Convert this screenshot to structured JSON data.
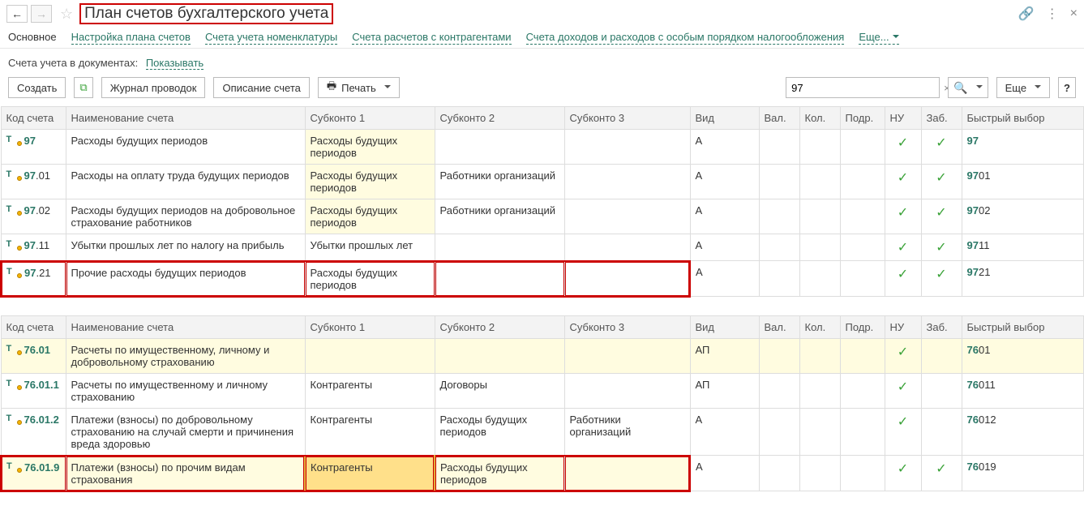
{
  "header": {
    "title": "План счетов бухгалтерского учета"
  },
  "tabs": {
    "main": "Основное",
    "setup": "Настройка плана счетов",
    "nomen": "Счета учета номенклатуры",
    "counter": "Счета расчетов с контрагентами",
    "tax": "Счета доходов и расходов с особым порядком налогообложения",
    "more": "Еще..."
  },
  "sub": {
    "label": "Счета учета в документах:",
    "value": "Показывать"
  },
  "toolbar": {
    "create": "Создать",
    "journal": "Журнал проводок",
    "describe": "Описание счета",
    "print": "Печать",
    "more": "Еще",
    "help": "?"
  },
  "search": {
    "value": "97"
  },
  "columns": {
    "code": "Код счета",
    "name": "Наименование счета",
    "sub1": "Субконто 1",
    "sub2": "Субконто 2",
    "sub3": "Субконто 3",
    "vid": "Вид",
    "val": "Вал.",
    "kol": "Кол.",
    "pod": "Подр.",
    "nu": "НУ",
    "zab": "Заб.",
    "fast": "Быстрый выбор"
  },
  "rows1": [
    {
      "icon": "plan",
      "code": "97",
      "codeSuf": "",
      "name": "Расходы будущих периодов",
      "sub1": "Расходы будущих периодов",
      "sub2": "",
      "sub3": "",
      "vid": "А",
      "nu": true,
      "zab": true,
      "fast": "97",
      "fastSuf": "",
      "hlSub1": true
    },
    {
      "icon": "acc",
      "code": "97",
      "codeSuf": ".01",
      "name": "Расходы на оплату труда будущих периодов",
      "sub1": "Расходы будущих периодов",
      "sub2": "Работники организаций",
      "sub3": "",
      "vid": "А",
      "nu": true,
      "zab": true,
      "fast": "97",
      "fastSuf": "01",
      "hlSub1": true
    },
    {
      "icon": "acc",
      "code": "97",
      "codeSuf": ".02",
      "name": "Расходы будущих периодов на добровольное страхование работников",
      "sub1": "Расходы будущих периодов",
      "sub2": "Работники организаций",
      "sub3": "",
      "vid": "А",
      "nu": true,
      "zab": true,
      "fast": "97",
      "fastSuf": "02",
      "hlSub1": true
    },
    {
      "icon": "acc",
      "code": "97",
      "codeSuf": ".11",
      "name": "Убытки прошлых лет по налогу на прибыль",
      "sub1": "Убытки прошлых лет",
      "sub2": "",
      "sub3": "",
      "vid": "А",
      "nu": true,
      "zab": true,
      "fast": "97",
      "fastSuf": "11"
    },
    {
      "icon": "acc",
      "code": "97",
      "codeSuf": ".21",
      "name": "Прочие расходы будущих периодов",
      "sub1": "Расходы будущих периодов",
      "sub2": "",
      "sub3": "",
      "vid": "А",
      "nu": true,
      "zab": true,
      "fast": "97",
      "fastSuf": "21",
      "redbox": true
    }
  ],
  "rows2": [
    {
      "icon": "acc",
      "code": "76.01",
      "codeSuf": "",
      "name": "Расчеты по имущественному, личному и добровольному страхованию",
      "sub1": "",
      "sub2": "",
      "sub3": "",
      "vid": "АП",
      "nu": true,
      "fast": "76",
      "fastSuf": "01",
      "rowHl": true
    },
    {
      "icon": "acc",
      "code": "76.01.1",
      "codeSuf": "",
      "name": "Расчеты по имущественному и личному страхованию",
      "sub1": "Контрагенты",
      "sub2": "Договоры",
      "sub3": "",
      "vid": "АП",
      "nu": true,
      "fast": "76",
      "fastSuf": "011"
    },
    {
      "icon": "acc",
      "code": "76.01.2",
      "codeSuf": "",
      "name": "Платежи (взносы) по добровольному страхованию на случай смерти и причинения вреда здоровью",
      "sub1": "Контрагенты",
      "sub2": "Расходы будущих периодов",
      "sub3": "Работники организаций",
      "vid": "А",
      "nu": true,
      "fast": "76",
      "fastSuf": "012"
    },
    {
      "icon": "acc",
      "code": "76.01.9",
      "codeSuf": "",
      "name": "Платежи (взносы) по прочим видам страхования",
      "sub1": "Контрагенты",
      "sub2": "Расходы будущих периодов",
      "sub3": "",
      "vid": "А",
      "nu": true,
      "zab": true,
      "fast": "76",
      "fastSuf": "019",
      "redbox": true,
      "rowHl2": true
    }
  ]
}
